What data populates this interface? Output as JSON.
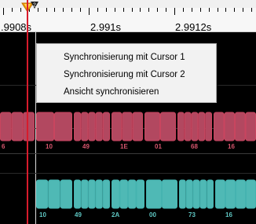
{
  "ruler": {
    "labels": [
      ".9908s",
      "2.991s",
      "2.9912s"
    ]
  },
  "cursor_markers": {
    "marker_1_icon": "cursor-1-marker",
    "marker_2_icon": "cursor-2-marker"
  },
  "context_menu": {
    "items": [
      "Synchronisierung mit Cursor 1",
      "Synchronisierung mit Cursor 2",
      "Ansicht synchronisieren"
    ]
  },
  "traces": {
    "red_bus": {
      "color": "#c9455f",
      "fill": "#b24860",
      "labels": [
        "6",
        "10",
        "49",
        "1E",
        "01",
        "68",
        "16"
      ]
    },
    "teal_bus": {
      "color": "#45b3b0",
      "fill": "#4fb9b5",
      "labels": [
        "10",
        "49",
        "2A",
        "00",
        "73",
        "16"
      ]
    }
  },
  "colors": {
    "cursor_1": "#d81b2c",
    "background": "#000000",
    "menu_bg": "#f2f2f2"
  }
}
